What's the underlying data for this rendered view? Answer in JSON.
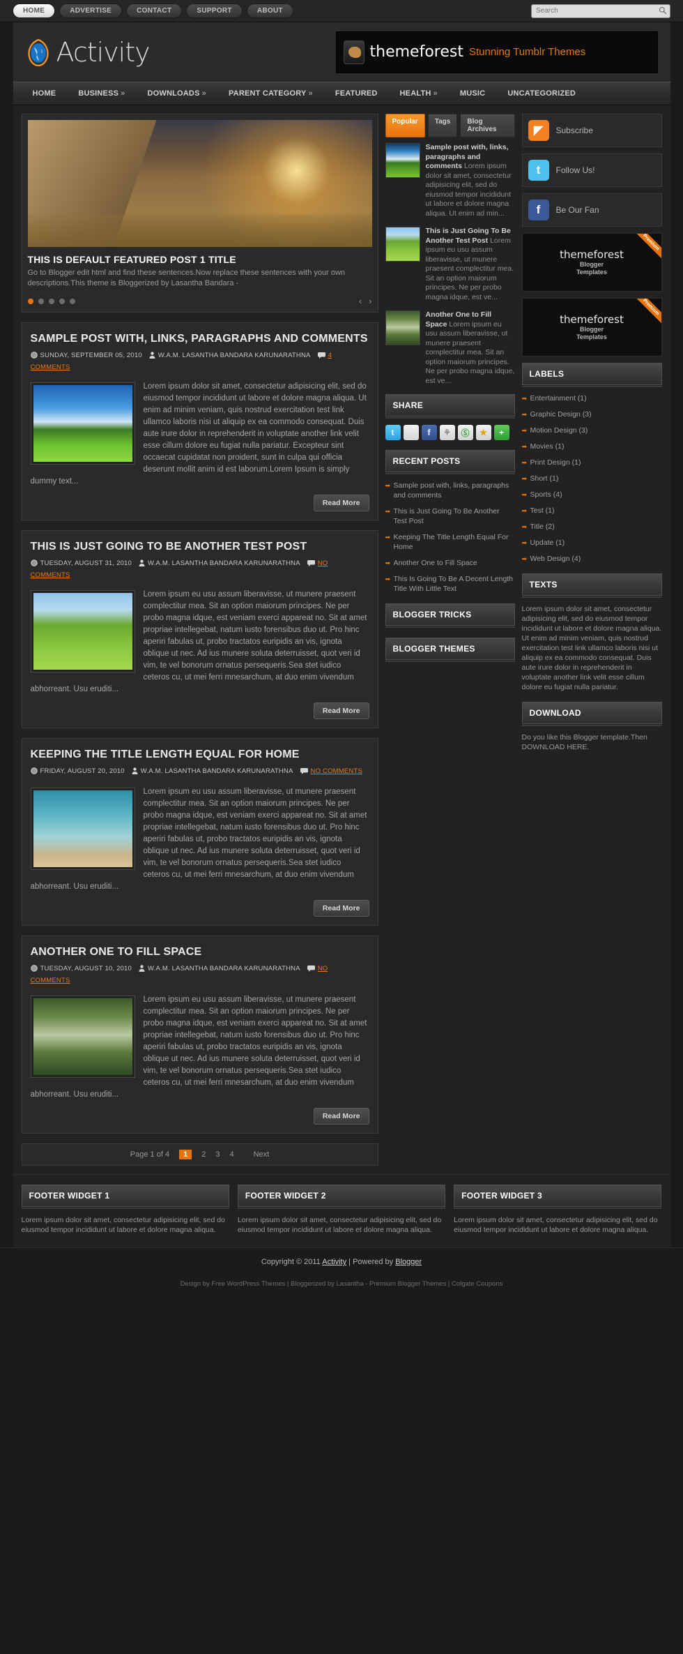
{
  "topbar": {
    "nav": [
      {
        "label": "HOME",
        "active": true
      },
      {
        "label": "ADVERTISE",
        "active": false
      },
      {
        "label": "CONTACT",
        "active": false
      },
      {
        "label": "SUPPORT",
        "active": false
      },
      {
        "label": "ABOUT",
        "active": false
      }
    ],
    "search_placeholder": "Search",
    "search_value": ""
  },
  "header": {
    "logo_text": "Activity",
    "banner_title": "themeforest",
    "banner_sub": "Stunning Tumblr Themes"
  },
  "mainnav": [
    {
      "label": "HOME",
      "caret": ""
    },
    {
      "label": "BUSINESS",
      "caret": "»"
    },
    {
      "label": "DOWNLOADS",
      "caret": "»"
    },
    {
      "label": "PARENT CATEGORY",
      "caret": "»"
    },
    {
      "label": "FEATURED",
      "caret": ""
    },
    {
      "label": "HEALTH",
      "caret": "»"
    },
    {
      "label": "MUSIC",
      "caret": ""
    },
    {
      "label": "UNCATEGORIZED",
      "caret": ""
    }
  ],
  "slider": {
    "title": "THIS IS DEFAULT FEATURED POST 1 TITLE",
    "desc": "Go to Blogger edit html and find these sentences.Now replace these sentences with your own descriptions.This theme is Bloggerized by Lasantha Bandara -",
    "dots": 5,
    "active_dot": 0,
    "prev": "‹",
    "next": "›"
  },
  "posts": [
    {
      "title": "SAMPLE POST WITH, LINKS, PARAGRAPHS AND COMMENTS",
      "date": "SUNDAY, SEPTEMBER 05, 2010",
      "author": "W.A.M. LASANTHA BANDARA KARUNARATHNA",
      "comments": "4 COMMENTS",
      "thumb_class": "t-clouds",
      "body": "Lorem ipsum dolor sit amet, consectetur adipisicing elit, sed do eiusmod tempor incididunt ut labore et dolore magna aliqua. Ut enim ad minim veniam, quis nostrud exercitation test link ullamco laboris nisi ut aliquip ex ea commodo consequat. Duis aute irure dolor in reprehenderit in voluptate another link velit esse cillum dolore eu fugiat nulla pariatur. Excepteur sint occaecat cupidatat non proident, sunt in culpa qui officia deserunt mollit anim id est laborum.Lorem Ipsum is simply dummy text...",
      "readmore": "Read More"
    },
    {
      "title": "THIS IS JUST GOING TO BE ANOTHER TEST POST",
      "date": "TUESDAY, AUGUST 31, 2010",
      "author": "W.A.M. LASANTHA BANDARA KARUNARATHNA",
      "comments": "NO COMMENTS",
      "thumb_class": "t-field",
      "body": "Lorem ipsum eu usu assum liberavisse, ut munere praesent complectitur mea. Sit an option maiorum principes. Ne per probo magna idque, est veniam exerci appareat no. Sit at amet propriae intellegebat, natum iusto forensibus duo ut. Pro hinc aperiri fabulas ut, probo tractatos euripidis an vis, ignota oblique ut nec. Ad ius munere soluta deterruisset, quot veri id vim, te vel bonorum ornatus persequeris.Sea stet iudico ceteros cu, ut mei ferri mnesarchum, at duo enim vivendum abhorreant. Usu eruditi...",
      "readmore": "Read More"
    },
    {
      "title": "KEEPING THE TITLE LENGTH EQUAL FOR HOME",
      "date": "FRIDAY, AUGUST 20, 2010",
      "author": "W.A.M. LASANTHA BANDARA KARUNARATHNA",
      "comments": "NO COMMENTS",
      "thumb_class": "t-reef",
      "body": "Lorem ipsum eu usu assum liberavisse, ut munere praesent complectitur mea. Sit an option maiorum principes. Ne per probo magna idque, est veniam exerci appareat no. Sit at amet propriae intellegebat, natum iusto forensibus duo ut. Pro hinc aperiri fabulas ut, probo tractatos euripidis an vis, ignota oblique ut nec. Ad ius munere soluta deterruisset, quot veri id vim, te vel bonorum ornatus persequeris.Sea stet iudico ceteros cu, ut mei ferri mnesarchum, at duo enim vivendum abhorreant. Usu eruditi...",
      "readmore": "Read More"
    },
    {
      "title": "ANOTHER ONE TO FILL SPACE",
      "date": "TUESDAY, AUGUST 10, 2010",
      "author": "W.A.M. LASANTHA BANDARA KARUNARATHNA",
      "comments": "NO COMMENTS",
      "thumb_class": "t-falls",
      "body": "Lorem ipsum eu usu assum liberavisse, ut munere praesent complectitur mea. Sit an option maiorum principes. Ne per probo magna idque, est veniam exerci appareat no. Sit at amet propriae intellegebat, natum iusto forensibus duo ut. Pro hinc aperiri fabulas ut, probo tractatos euripidis an vis, ignota oblique ut nec. Ad ius munere soluta deterruisset, quot veri id vim, te vel bonorum ornatus persequeris.Sea stet iudico ceteros cu, ut mei ferri mnesarchum, at duo enim vivendum abhorreant. Usu eruditi...",
      "readmore": "Read More"
    }
  ],
  "pagination": {
    "info": "Page 1 of 4",
    "pages": [
      "1",
      "2",
      "3",
      "4"
    ],
    "current": "1",
    "next": "Next"
  },
  "midcol": {
    "tabs": [
      {
        "label": "Popular",
        "active": true
      },
      {
        "label": "Tags",
        "active": false
      },
      {
        "label": "Blog Archives",
        "active": false
      }
    ],
    "popular": [
      {
        "title": "Sample post with, links, paragraphs and comments",
        "excerpt": "Lorem ipsum dolor sit amet, consectetur adipisicing elit, sed do eiusmod tempor incididunt ut labore et dolore magna aliqua. Ut enim ad min...",
        "thumb_class": "t-sun"
      },
      {
        "title": "This is Just Going To Be Another Test Post",
        "excerpt": "Lorem ipsum eu usu assum liberavisse, ut munere praesent complectitur mea. Sit an option maiorum principes. Ne per probo magna idque, est ve...",
        "thumb_class": "t-field"
      },
      {
        "title": "Another One to Fill Space",
        "excerpt": "Lorem ipsum eu usu assum liberavisse, ut munere praesent complectitur mea. Sit an option maiorum principes. Ne per probo magna idque, est ve...",
        "thumb_class": "t-falls"
      }
    ],
    "share_title": "SHARE",
    "share_buttons": [
      "twitter-icon",
      "delicious-icon",
      "facebook-icon",
      "myspace-icon",
      "stumbleupon-icon",
      "favorites-icon",
      "addthis-icon"
    ],
    "recent_title": "RECENT POSTS",
    "recent_posts": [
      "Sample post with, links, paragraphs and comments",
      "This is Just Going To Be Another Test Post",
      "Keeping The Title Length Equal For Home",
      "Another One to Fill Space",
      "This Is Going To Be A Decent Length Title With Little Text"
    ],
    "blogger_tricks_title": "BLOGGER TRICKS",
    "blogger_themes_title": "BLOGGER THEMES"
  },
  "sidebar": {
    "social": [
      {
        "label": "Subscribe",
        "icon": "rss-icon",
        "color": "#f08020",
        "glyph": "◤"
      },
      {
        "label": "Follow Us!",
        "icon": "twitter-icon",
        "color": "#4dc2f0",
        "glyph": "t"
      },
      {
        "label": "Be Our Fan",
        "icon": "facebook-icon",
        "color": "#3b5998",
        "glyph": "f"
      }
    ],
    "ads": [
      {
        "ribbon": "Premium",
        "title": "themeforest",
        "sub": "Blogger\nTemplates"
      },
      {
        "ribbon": "Premium",
        "title": "themeforest",
        "sub": "Blogger\nTemplates"
      }
    ],
    "labels_title": "LABELS",
    "labels": [
      "Entertainment (1)",
      "Graphic Design (3)",
      "Motion Design (3)",
      "Movies (1)",
      "Print Design (1)",
      "Short (1)",
      "Sports (4)",
      "Test (1)",
      "Title (2)",
      "Update (1)",
      "Web Design (4)"
    ],
    "texts_title": "TEXTS",
    "texts_body": "Lorem ipsum dolor sit amet, consectetur adipisicing elit, sed do eiusmod tempor incididunt ut labore et dolore magna aliqua. Ut enim ad minim veniam, quis nostrud exercitation test link ullamco laboris nisi ut aliquip ex ea commodo consequat. Duis aute irure dolor in reprehenderit in voluptate another link velit esse cillum dolore eu fugiat nulla pariatur.",
    "download_title": "DOWNLOAD",
    "download_body": "Do you like this Blogger template.Then DOWNLOAD HERE."
  },
  "footer": {
    "widgets": [
      {
        "title": "FOOTER WIDGET 1",
        "body": "Lorem ipsum dolor sit amet, consectetur adipisicing elit, sed do eiusmod tempor incididunt ut labore et dolore magna aliqua."
      },
      {
        "title": "FOOTER WIDGET 2",
        "body": "Lorem ipsum dolor sit amet, consectetur adipisicing elit, sed do eiusmod tempor incididunt ut labore et dolore magna aliqua."
      },
      {
        "title": "FOOTER WIDGET 3",
        "body": "Lorem ipsum dolor sit amet, consectetur adipisicing elit, sed do eiusmod tempor incididunt ut labore et dolore magna aliqua."
      }
    ],
    "copyright_pre": "Copyright © 2011 ",
    "copyright_link": "Activity",
    "copyright_mid": " | Powered by ",
    "copyright_link2": "Blogger",
    "credits": "Design by Free WordPress Themes | Bloggerized by Lasantha - Premium Blogger Themes | Colgate Coupons"
  }
}
